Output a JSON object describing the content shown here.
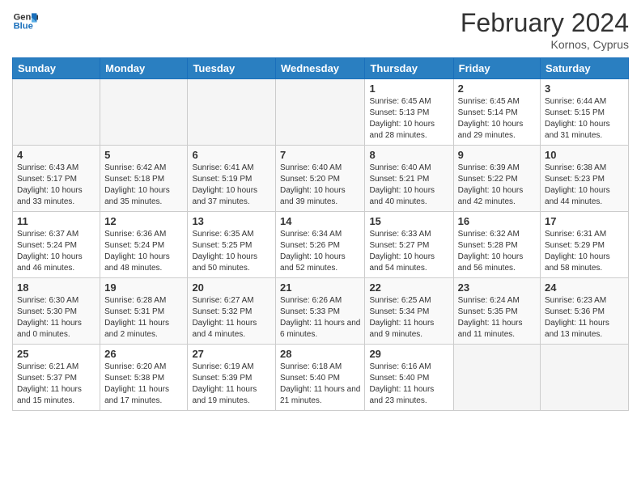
{
  "header": {
    "logo_line1": "General",
    "logo_line2": "Blue",
    "month_year": "February 2024",
    "location": "Kornos, Cyprus"
  },
  "days_of_week": [
    "Sunday",
    "Monday",
    "Tuesday",
    "Wednesday",
    "Thursday",
    "Friday",
    "Saturday"
  ],
  "weeks": [
    [
      {
        "day": "",
        "info": ""
      },
      {
        "day": "",
        "info": ""
      },
      {
        "day": "",
        "info": ""
      },
      {
        "day": "",
        "info": ""
      },
      {
        "day": "1",
        "info": "Sunrise: 6:45 AM\nSunset: 5:13 PM\nDaylight: 10 hours and 28 minutes."
      },
      {
        "day": "2",
        "info": "Sunrise: 6:45 AM\nSunset: 5:14 PM\nDaylight: 10 hours and 29 minutes."
      },
      {
        "day": "3",
        "info": "Sunrise: 6:44 AM\nSunset: 5:15 PM\nDaylight: 10 hours and 31 minutes."
      }
    ],
    [
      {
        "day": "4",
        "info": "Sunrise: 6:43 AM\nSunset: 5:17 PM\nDaylight: 10 hours and 33 minutes."
      },
      {
        "day": "5",
        "info": "Sunrise: 6:42 AM\nSunset: 5:18 PM\nDaylight: 10 hours and 35 minutes."
      },
      {
        "day": "6",
        "info": "Sunrise: 6:41 AM\nSunset: 5:19 PM\nDaylight: 10 hours and 37 minutes."
      },
      {
        "day": "7",
        "info": "Sunrise: 6:40 AM\nSunset: 5:20 PM\nDaylight: 10 hours and 39 minutes."
      },
      {
        "day": "8",
        "info": "Sunrise: 6:40 AM\nSunset: 5:21 PM\nDaylight: 10 hours and 40 minutes."
      },
      {
        "day": "9",
        "info": "Sunrise: 6:39 AM\nSunset: 5:22 PM\nDaylight: 10 hours and 42 minutes."
      },
      {
        "day": "10",
        "info": "Sunrise: 6:38 AM\nSunset: 5:23 PM\nDaylight: 10 hours and 44 minutes."
      }
    ],
    [
      {
        "day": "11",
        "info": "Sunrise: 6:37 AM\nSunset: 5:24 PM\nDaylight: 10 hours and 46 minutes."
      },
      {
        "day": "12",
        "info": "Sunrise: 6:36 AM\nSunset: 5:24 PM\nDaylight: 10 hours and 48 minutes."
      },
      {
        "day": "13",
        "info": "Sunrise: 6:35 AM\nSunset: 5:25 PM\nDaylight: 10 hours and 50 minutes."
      },
      {
        "day": "14",
        "info": "Sunrise: 6:34 AM\nSunset: 5:26 PM\nDaylight: 10 hours and 52 minutes."
      },
      {
        "day": "15",
        "info": "Sunrise: 6:33 AM\nSunset: 5:27 PM\nDaylight: 10 hours and 54 minutes."
      },
      {
        "day": "16",
        "info": "Sunrise: 6:32 AM\nSunset: 5:28 PM\nDaylight: 10 hours and 56 minutes."
      },
      {
        "day": "17",
        "info": "Sunrise: 6:31 AM\nSunset: 5:29 PM\nDaylight: 10 hours and 58 minutes."
      }
    ],
    [
      {
        "day": "18",
        "info": "Sunrise: 6:30 AM\nSunset: 5:30 PM\nDaylight: 11 hours and 0 minutes."
      },
      {
        "day": "19",
        "info": "Sunrise: 6:28 AM\nSunset: 5:31 PM\nDaylight: 11 hours and 2 minutes."
      },
      {
        "day": "20",
        "info": "Sunrise: 6:27 AM\nSunset: 5:32 PM\nDaylight: 11 hours and 4 minutes."
      },
      {
        "day": "21",
        "info": "Sunrise: 6:26 AM\nSunset: 5:33 PM\nDaylight: 11 hours and 6 minutes."
      },
      {
        "day": "22",
        "info": "Sunrise: 6:25 AM\nSunset: 5:34 PM\nDaylight: 11 hours and 9 minutes."
      },
      {
        "day": "23",
        "info": "Sunrise: 6:24 AM\nSunset: 5:35 PM\nDaylight: 11 hours and 11 minutes."
      },
      {
        "day": "24",
        "info": "Sunrise: 6:23 AM\nSunset: 5:36 PM\nDaylight: 11 hours and 13 minutes."
      }
    ],
    [
      {
        "day": "25",
        "info": "Sunrise: 6:21 AM\nSunset: 5:37 PM\nDaylight: 11 hours and 15 minutes."
      },
      {
        "day": "26",
        "info": "Sunrise: 6:20 AM\nSunset: 5:38 PM\nDaylight: 11 hours and 17 minutes."
      },
      {
        "day": "27",
        "info": "Sunrise: 6:19 AM\nSunset: 5:39 PM\nDaylight: 11 hours and 19 minutes."
      },
      {
        "day": "28",
        "info": "Sunrise: 6:18 AM\nSunset: 5:40 PM\nDaylight: 11 hours and 21 minutes."
      },
      {
        "day": "29",
        "info": "Sunrise: 6:16 AM\nSunset: 5:40 PM\nDaylight: 11 hours and 23 minutes."
      },
      {
        "day": "",
        "info": ""
      },
      {
        "day": "",
        "info": ""
      }
    ]
  ]
}
